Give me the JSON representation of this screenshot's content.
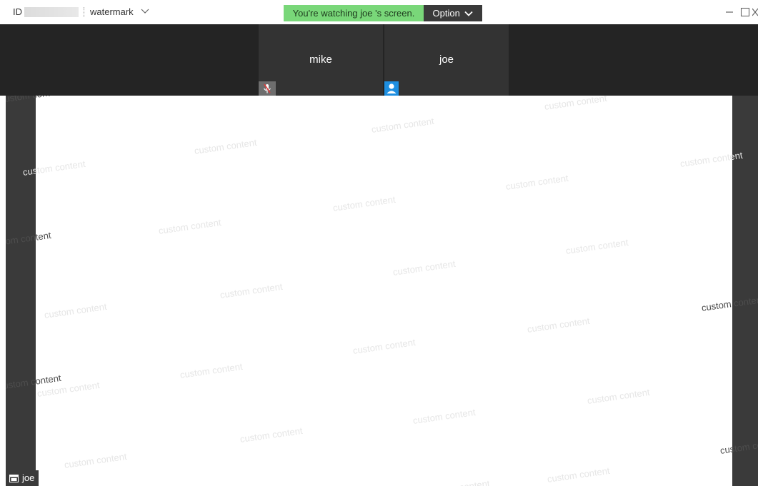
{
  "titlebar": {
    "id_label": "ID",
    "watermark_label": "watermark",
    "banner_text": "You're watching  joe 's screen.",
    "option_label": "Option"
  },
  "participants": [
    {
      "name": "mike",
      "badge": "mic-muted-icon",
      "badge_color": "#6e6e6e"
    },
    {
      "name": "joe",
      "badge": "person-icon",
      "badge_color": "#1e8fe1"
    }
  ],
  "shared_screen": {
    "sharer_name": "joe",
    "watermark_text": "custom content"
  },
  "colors": {
    "banner_green": "#79d779",
    "option_dark": "#3a3a3a",
    "strip_bg": "#242424",
    "tile_bg": "#333333",
    "accent_blue": "#1e8fe1"
  }
}
